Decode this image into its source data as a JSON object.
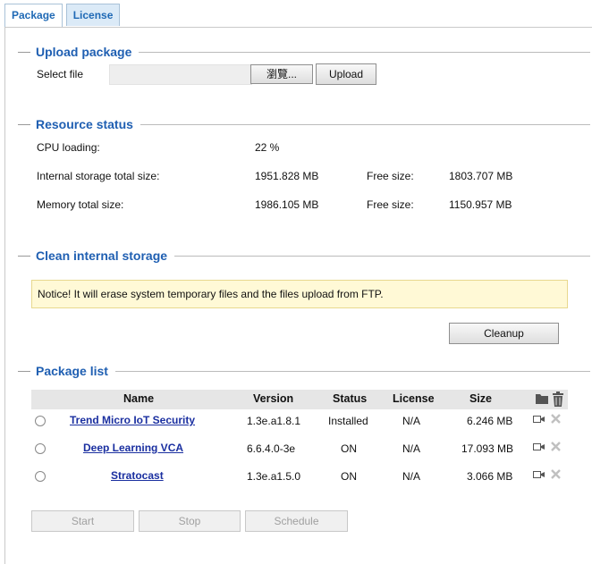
{
  "tabs": [
    {
      "label": "Package",
      "active": true
    },
    {
      "label": "License",
      "active": false
    }
  ],
  "upload": {
    "title": "Upload package",
    "select_label": "Select file",
    "browse_label": "瀏覽...",
    "upload_label": "Upload"
  },
  "resource": {
    "title": "Resource status",
    "cpu_label": "CPU loading:",
    "cpu_value": "22 %",
    "storage_label": "Internal storage total size:",
    "storage_total": "1951.828 MB",
    "storage_free_label": "Free size:",
    "storage_free": "1803.707 MB",
    "memory_label": "Memory total size:",
    "memory_total": "1986.105 MB",
    "memory_free_label": "Free size:",
    "memory_free": "1150.957 MB"
  },
  "clean": {
    "title": "Clean internal storage",
    "notice": "Notice! It will erase system temporary files and the files upload from FTP.",
    "cleanup_label": "Cleanup"
  },
  "packages": {
    "title": "Package list",
    "headers": {
      "name": "Name",
      "version": "Version",
      "status": "Status",
      "license": "License",
      "size": "Size"
    },
    "rows": [
      {
        "name": "Trend Micro IoT Security",
        "version": "1.3e.a1.8.1",
        "status": "Installed",
        "license": "N/A",
        "size": "6.246 MB"
      },
      {
        "name": "Deep Learning VCA",
        "version": "6.6.4.0-3e",
        "status": "ON",
        "license": "N/A",
        "size": "17.093 MB"
      },
      {
        "name": "Stratocast",
        "version": "1.3e.a1.5.0",
        "status": "ON",
        "license": "N/A",
        "size": "3.066 MB"
      }
    ]
  },
  "actions": {
    "start_label": "Start",
    "stop_label": "Stop",
    "schedule_label": "Schedule"
  },
  "colors": {
    "accent": "#1f5fb2",
    "link": "#1a2fa0",
    "notice_bg": "#fff9d6",
    "header_bg": "#e6e6e6"
  }
}
